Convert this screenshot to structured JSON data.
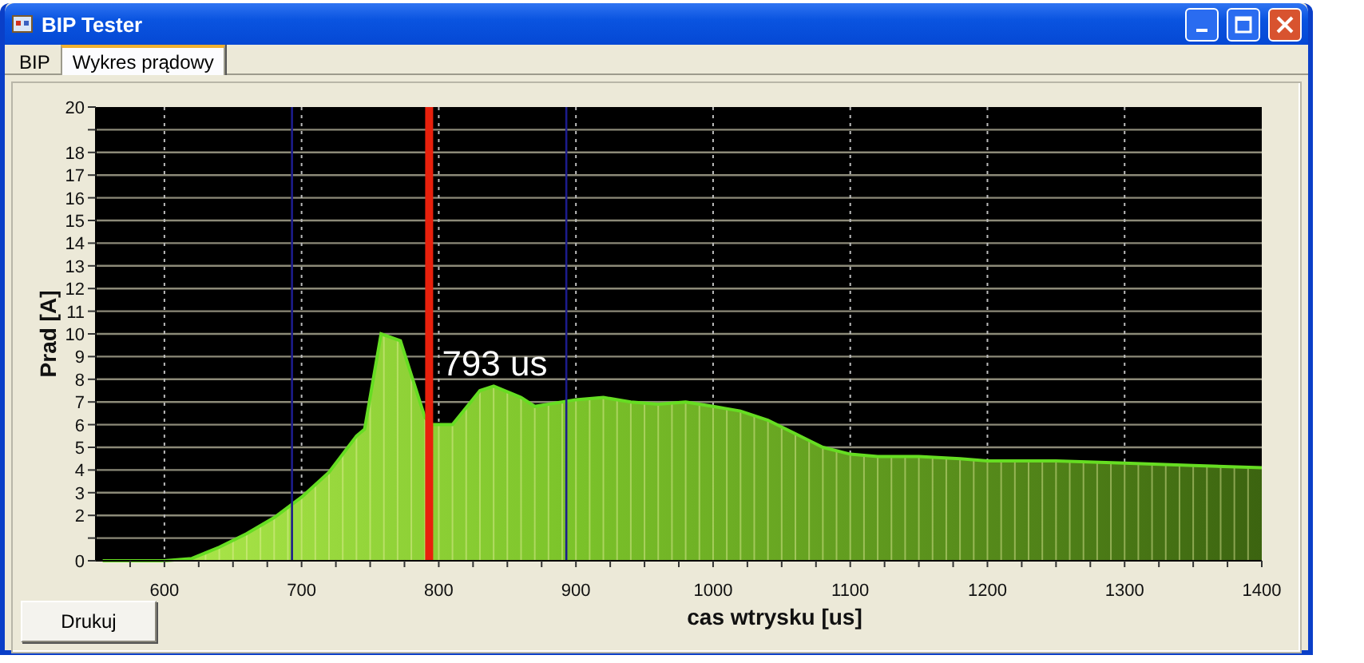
{
  "window": {
    "title": "BIP Tester"
  },
  "tabs": [
    {
      "label": "BIP",
      "selected": false
    },
    {
      "label": "Wykres prądowy",
      "selected": true
    }
  ],
  "chart": {
    "chart_data": {
      "type": "area",
      "xlabel": "cas wtrysku [us]",
      "ylabel": "Prad [A]",
      "x": [
        555,
        600,
        620,
        640,
        660,
        680,
        700,
        720,
        740,
        746,
        758,
        772,
        790,
        795,
        810,
        830,
        840,
        860,
        870,
        880,
        900,
        920,
        940,
        960,
        980,
        1000,
        1020,
        1040,
        1060,
        1080,
        1100,
        1120,
        1150,
        1180,
        1200,
        1250,
        1300,
        1350,
        1400
      ],
      "series": [
        {
          "color": "#66dd22",
          "values": [
            0,
            0,
            0.1,
            0.6,
            1.2,
            1.9,
            2.8,
            3.9,
            5.5,
            5.8,
            10,
            9.7,
            6.3,
            6.0,
            6.0,
            7.5,
            7.7,
            7.2,
            6.8,
            6.9,
            7.1,
            7.2,
            7.0,
            6.9,
            7.0,
            6.8,
            6.6,
            6.2,
            5.6,
            5.0,
            4.7,
            4.6,
            4.6,
            4.5,
            4.4,
            4.4,
            4.3,
            4.2,
            4.1
          ]
        }
      ],
      "xlim": [
        550,
        1400
      ],
      "ylim": [
        0,
        20
      ],
      "xticks": [
        600,
        700,
        800,
        900,
        1000,
        1100,
        1200,
        1300,
        1400
      ],
      "yticks": [
        0,
        2,
        3,
        4,
        5,
        6,
        7,
        8,
        9,
        10,
        11,
        12,
        13,
        14,
        15,
        16,
        17,
        18,
        20
      ],
      "grid": true,
      "ref_lines": [
        {
          "axis": "x",
          "value": 693,
          "color": "#1c1c8c"
        },
        {
          "axis": "x",
          "value": 893,
          "color": "#1c1c8c"
        },
        {
          "axis": "x",
          "value": 793,
          "label": "793 us",
          "color": "#e8200c"
        }
      ]
    }
  },
  "buttons": [
    {
      "label": "Drukuj"
    }
  ]
}
